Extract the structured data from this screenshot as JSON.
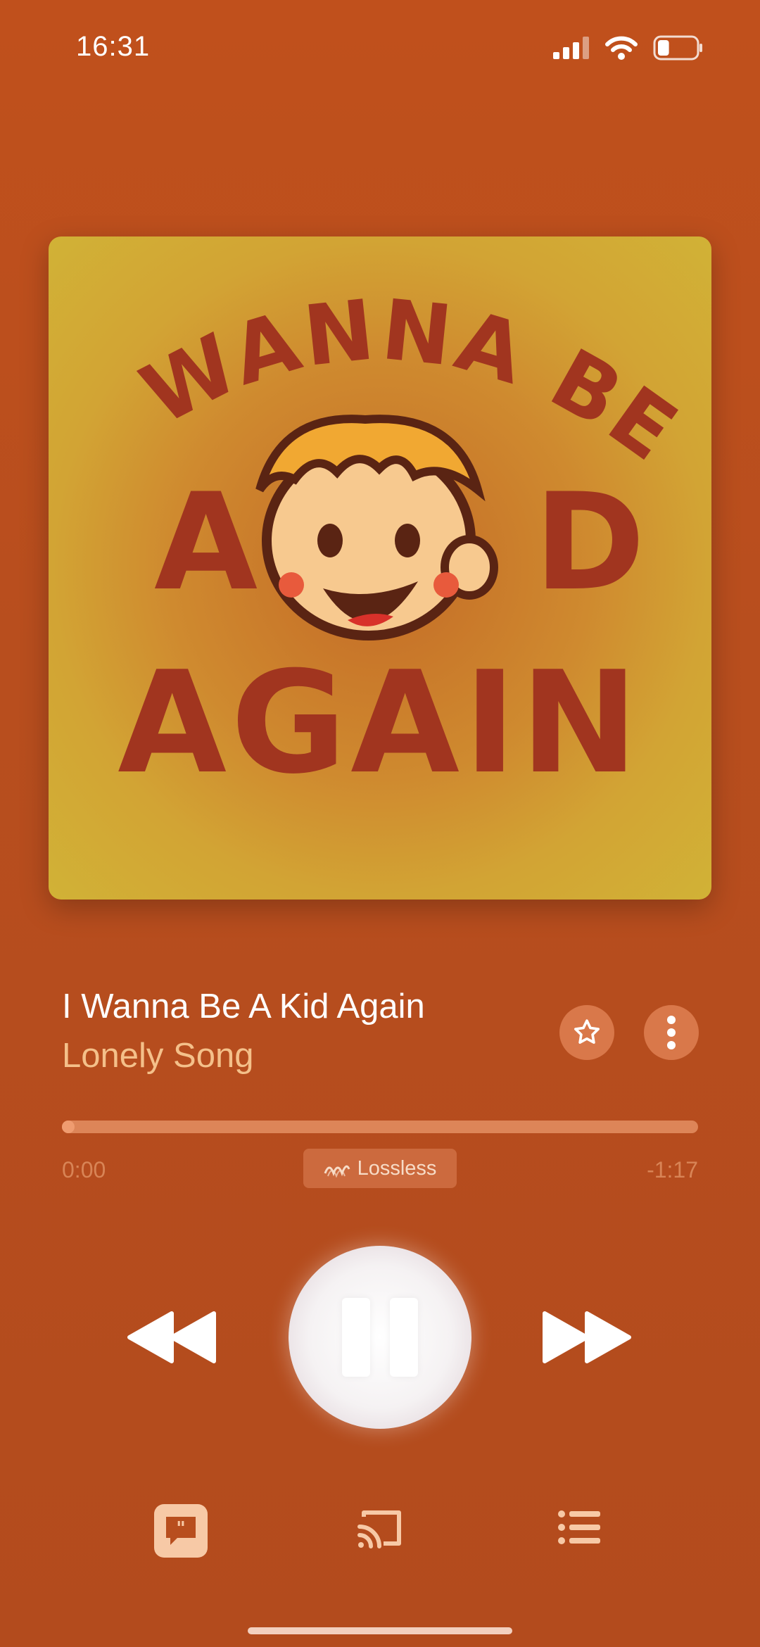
{
  "status_bar": {
    "time": "16:31",
    "battery_level": 0.3
  },
  "album": {
    "art_text_line1": "I WANNA BE",
    "art_text_a": "A",
    "art_text_d": "D",
    "art_text_line3": "AGAIN",
    "background_color": "#d1b236",
    "text_color": "#a1351f"
  },
  "track": {
    "title": "I Wanna Be A Kid Again",
    "artist": "Lonely Song"
  },
  "progress": {
    "elapsed": "0:00",
    "remaining": "-1:17",
    "fraction": 0.0
  },
  "badge": {
    "label": "Lossless"
  },
  "icons": {
    "star": "star-icon",
    "more": "more-vertical-icon",
    "rewind": "rewind-icon",
    "pause": "pause-icon",
    "forward": "fast-forward-icon",
    "lyrics": "lyrics-icon",
    "cast": "cast-icon",
    "queue": "queue-list-icon"
  },
  "colors": {
    "background": "#b84e1e",
    "accent": "#f4c08a"
  }
}
